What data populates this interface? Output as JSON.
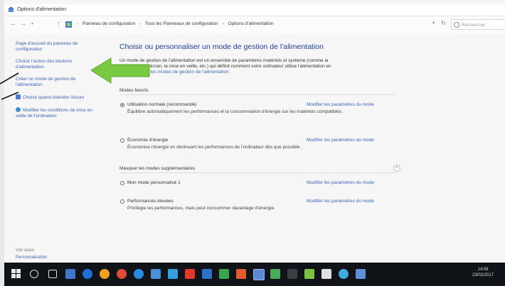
{
  "window": {
    "title": "Options d'alimentation"
  },
  "addressbar": {
    "back": "←",
    "forward": "→",
    "up": "↑",
    "breadcrumb": [
      "Panneau de configuration",
      "Tous les Panneaux de configuration",
      "Options d'alimentation"
    ],
    "search_placeholder": "Rechercher"
  },
  "sidebar": {
    "links": [
      "Page d'accueil du panneau de configuration",
      "Choisir l'action des boutons d'alimentation",
      "Créer un mode de gestion de l'alimentation",
      "Choisir quand éteindre l'écran",
      "Modifier les conditions de mise en veille de l'ordinateur"
    ],
    "see_also": "Voir aussi",
    "network": "Personnalisation"
  },
  "main": {
    "title": "Choisir ou personnaliser un mode de gestion de l'alimentation",
    "description_line1": "Un mode de gestion de l'alimentation est un ensemble de paramètres matériels et système (comme la",
    "description_line2": "luminosité de l'écran, la mise en veille, etc.) qui définit comment votre ordinateur utilise l'alimentation en",
    "description_link": "savoir plus sur les modes de gestion de l'alimentation",
    "preferred_group": "Modes favoris",
    "plans": [
      {
        "name": "Utilisation normale (recommandé)",
        "selected": true,
        "modify": "Modifier les paramètres du mode",
        "description": "Équilibre automatiquement les performances et la consommation d'énergie sur les matériels compatibles."
      },
      {
        "name": "Économie d'énergie",
        "selected": false,
        "modify": "Modifier les paramètres du mode",
        "description": "Économise l'énergie en diminuant les performances de l'ordinateur dès que possible."
      }
    ],
    "extra_group": "Masquer les modes supplémentaires",
    "extra_plans": [
      {
        "name": "Mon mode personnalisé 1",
        "selected": false,
        "modify": "Modifier les paramètres du mode",
        "description": ""
      },
      {
        "name": "Performances élevées",
        "selected": false,
        "modify": "Modifier les paramètres du mode",
        "description": "Privilégie les performances, mais peut consommer davantage d'énergie."
      }
    ]
  },
  "taskbar": {
    "time": "14:08",
    "date": "23/02/2017"
  },
  "colors": {
    "link": "#3a64b8",
    "title": "#1e3f9a",
    "annotation_arrow": "#7ac943",
    "taskbar": "#101418"
  }
}
